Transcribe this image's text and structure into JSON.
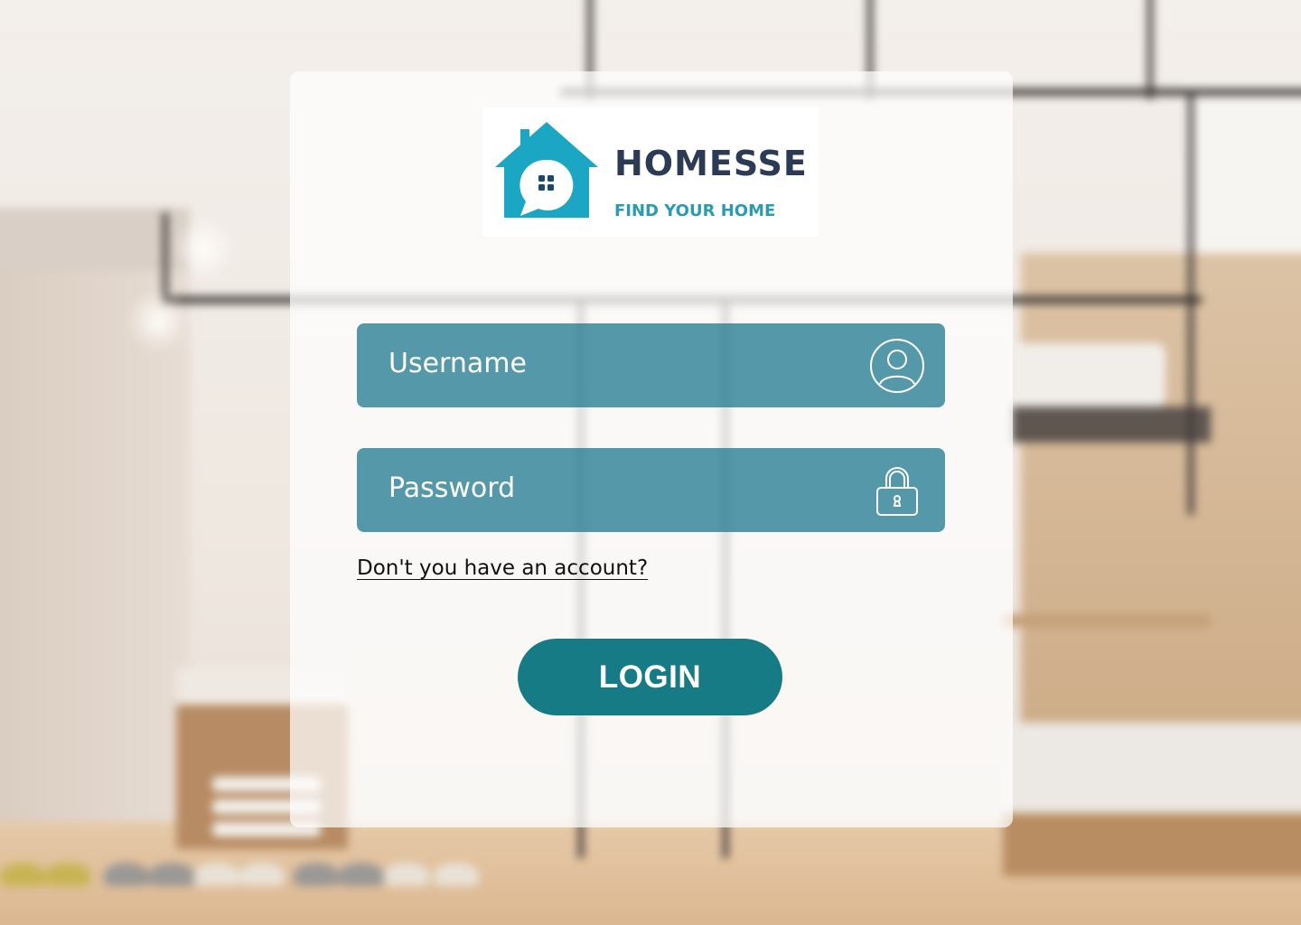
{
  "brand": {
    "name": "HOMESSE",
    "tagline": "FIND YOUR HOME",
    "logo_icon": "house-chat-icon",
    "colors": {
      "primary": "#1BA6C4",
      "dark": "#2B3A55",
      "button": "#177B85"
    }
  },
  "login_form": {
    "username_placeholder": "Username",
    "username_icon": "user-icon",
    "password_placeholder": "Password",
    "password_icon": "lock-icon",
    "signup_link": "Don't you have an account?",
    "login_button": "LOGIN"
  }
}
